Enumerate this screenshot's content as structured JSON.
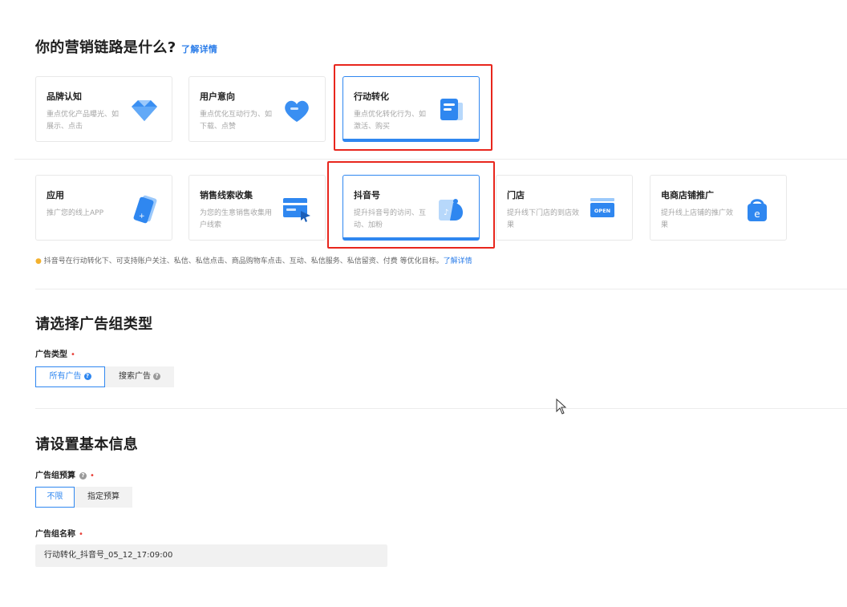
{
  "section_marketing": {
    "title": "你的营销链路是什么?",
    "learn_more": "了解详情"
  },
  "cards_row1": [
    {
      "title": "品牌认知",
      "desc": "重点优化产品曝光、如展示、点击",
      "icon": "diamond-icon"
    },
    {
      "title": "用户意向",
      "desc": "重点优化互动行为、如下载、点赞",
      "icon": "heart-icon"
    },
    {
      "title": "行动转化",
      "desc": "重点优化转化行为、如激活、购买",
      "icon": "document-icon"
    }
  ],
  "cards_row2": [
    {
      "title": "应用",
      "desc": "推广您的线上APP",
      "icon": "app-phone-icon"
    },
    {
      "title": "销售线索收集",
      "desc": "为您的生意销售收集用户线索",
      "icon": "form-card-icon"
    },
    {
      "title": "抖音号",
      "desc": "提升抖音号的访问、互动、加粉",
      "icon": "douyin-icon"
    },
    {
      "title": "门店",
      "desc": "提升线下门店的到店效果",
      "icon": "open-sign-icon",
      "badge": "OPEN"
    },
    {
      "title": "电商店铺推广",
      "desc": "提升线上店铺的推广效果",
      "icon": "shopping-bag-icon",
      "badge": "e"
    }
  ],
  "tip": {
    "text": "抖音号在行动转化下、可支持账户关注、私信、私信点击、商品购物车点击、互动、私信服务、私信留资、付费 等优化目标。",
    "link": "了解详情"
  },
  "section_adgroup": {
    "title": "请选择广告组类型",
    "field_label": "广告类型",
    "required_mark": "•",
    "options": [
      {
        "label": "所有广告",
        "selected": true
      },
      {
        "label": "搜索广告",
        "selected": false
      }
    ]
  },
  "section_basic": {
    "title": "请设置基本信息",
    "budget_label": "广告组预算",
    "budget_options": [
      {
        "label": "不限",
        "selected": true
      },
      {
        "label": "指定预算",
        "selected": false
      }
    ],
    "name_label": "广告组名称",
    "name_value": "行动转化_抖音号_05_12_17:09:00"
  },
  "colors": {
    "accent": "#2f87f0",
    "highlight_box": "#e8261d",
    "required": "#e8413a"
  }
}
